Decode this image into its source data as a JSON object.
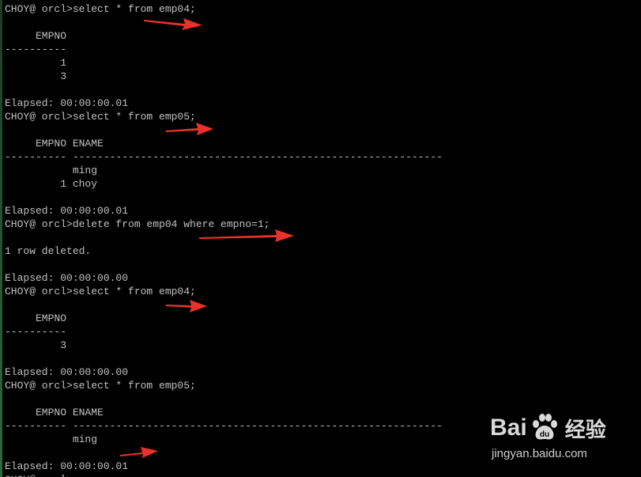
{
  "console": {
    "lines": [
      "CHOY@ orcl>select * from emp04;",
      "",
      "     EMPNO",
      "----------",
      "         1",
      "         3",
      "",
      "Elapsed: 00:00:00.01",
      "CHOY@ orcl>select * from emp05;",
      "",
      "     EMPNO ENAME",
      "---------- ------------------------------------------------------------",
      "           ming",
      "         1 choy",
      "",
      "Elapsed: 00:00:00.01",
      "CHOY@ orcl>delete from emp04 where empno=1;",
      "",
      "1 row deleted.",
      "",
      "Elapsed: 00:00:00.00",
      "CHOY@ orcl>select * from emp04;",
      "",
      "     EMPNO",
      "----------",
      "         3",
      "",
      "Elapsed: 00:00:00.00",
      "CHOY@ orcl>select * from emp05;",
      "",
      "     EMPNO ENAME",
      "---------- ------------------------------------------------------------",
      "           ming",
      "",
      "Elapsed: 00:00:00.01",
      "CHOY@ orcl>"
    ]
  },
  "watermark": {
    "brand_left": "Bai",
    "brand_right": "经验",
    "url": "jingyan.baidu.com"
  },
  "colors": {
    "background": "#000000",
    "text": "#c0c0c0",
    "arrow": "#e8322b"
  },
  "icons": [
    "arrow-annotation-icon",
    "baidu-paw-icon"
  ]
}
